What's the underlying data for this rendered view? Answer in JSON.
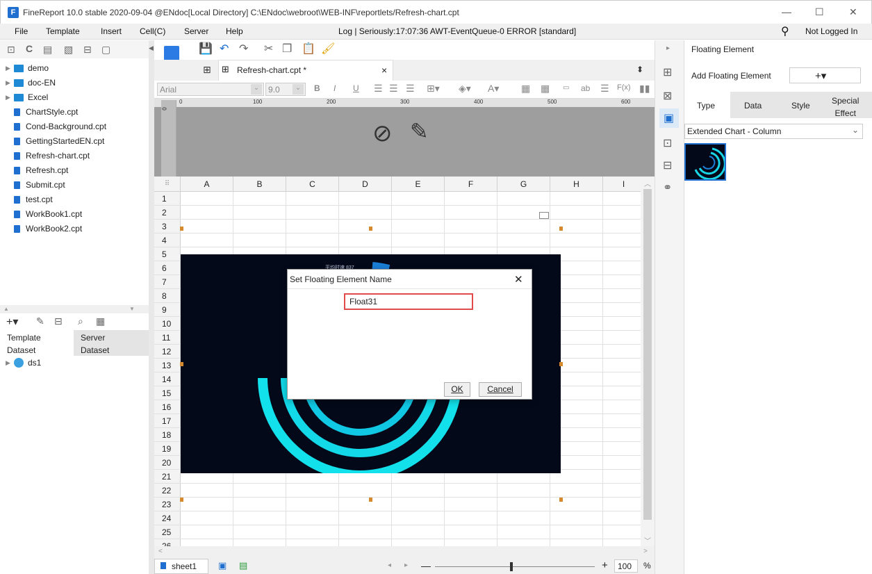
{
  "window": {
    "title": "FineReport 10.0 stable 2020-09-04 @ENdoc[Local Directory]    C:\\ENdoc\\webroot\\WEB-INF\\reportlets/Refresh-chart.cpt",
    "min": "—",
    "max": "☐",
    "close": "✕"
  },
  "menu": {
    "items": [
      "File",
      "Template",
      "Insert",
      "Cell(C)",
      "Server",
      "Help"
    ],
    "log": "Log | Seriously:17:07:36 AWT-EventQueue-0 ERROR [standard]",
    "login": "Not Logged In"
  },
  "tree": {
    "items": [
      {
        "label": "demo",
        "type": "folder"
      },
      {
        "label": "doc-EN",
        "type": "folder"
      },
      {
        "label": "Excel",
        "type": "folder"
      },
      {
        "label": "ChartStyle.cpt",
        "type": "file"
      },
      {
        "label": "Cond-Background.cpt",
        "type": "file"
      },
      {
        "label": "GettingStartedEN.cpt",
        "type": "file"
      },
      {
        "label": "Refresh-chart.cpt",
        "type": "file"
      },
      {
        "label": "Refresh.cpt",
        "type": "file"
      },
      {
        "label": "Submit.cpt",
        "type": "file"
      },
      {
        "label": "test.cpt",
        "type": "file"
      },
      {
        "label": "WorkBook1.cpt",
        "type": "file"
      },
      {
        "label": "WorkBook2.cpt",
        "type": "file"
      }
    ]
  },
  "dataset": {
    "tab_template": "Template\nDataset",
    "tab_server": "Server\nDataset",
    "items": [
      "ds1"
    ]
  },
  "doc": {
    "tab": "Refresh-chart.cpt *",
    "close": "×"
  },
  "format": {
    "font": "Arial",
    "size": "9.0"
  },
  "ruler": {
    "ticks": [
      "0",
      "100",
      "200",
      "300",
      "400",
      "500",
      "600"
    ]
  },
  "grid": {
    "cols": [
      "A",
      "B",
      "C",
      "D",
      "E",
      "F",
      "G",
      "H",
      "I"
    ],
    "rows": [
      "1",
      "2",
      "3",
      "4",
      "5",
      "6",
      "7",
      "8",
      "9",
      "10",
      "11",
      "12",
      "13",
      "14",
      "15",
      "16",
      "17",
      "18",
      "19",
      "20",
      "21",
      "22",
      "23",
      "24",
      "25",
      "26"
    ]
  },
  "sheet": {
    "name": "sheet1",
    "zoom": "100",
    "percent": "%",
    "minus": "—",
    "plus": "+"
  },
  "right": {
    "title": "Floating Element",
    "add_label": "Add Floating Element",
    "add_btn": "+▾",
    "tabs": [
      "Type",
      "Data",
      "Style",
      "Special\nEffect"
    ],
    "chart_type": "Extended Chart - Column"
  },
  "dialog": {
    "title": "Set Floating Element Name",
    "value": "Float31",
    "ok": "OK",
    "cancel": "Cancel",
    "close": "✕"
  },
  "chart": {
    "label": "平均时速  837"
  }
}
